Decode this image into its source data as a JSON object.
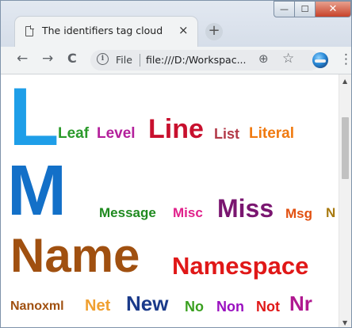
{
  "window": {
    "tab_title": "The identifiers tag cloud",
    "tab_close": "×",
    "new_tab": "+",
    "min_label": "—",
    "max_label": "☐",
    "close_label": "✕"
  },
  "toolbar": {
    "back": "←",
    "forward": "→",
    "reload": "C",
    "scheme": "File",
    "url": "file:///D:/Workspac...",
    "zoom": "⊕",
    "star": "☆",
    "menu": "⋮"
  },
  "tag_cloud": {
    "words": [
      {
        "text": "L",
        "color": "#1e9ee8"
      },
      {
        "text": "Leaf",
        "color": "#2a9a2a"
      },
      {
        "text": "Level",
        "color": "#b4209c"
      },
      {
        "text": "Line",
        "color": "#c8102e"
      },
      {
        "text": "List",
        "color": "#b23a48"
      },
      {
        "text": "Literal",
        "color": "#f07a10"
      },
      {
        "text": "M",
        "color": "#1370c8"
      },
      {
        "text": "Message",
        "color": "#1f8a1f"
      },
      {
        "text": "Misc",
        "color": "#e0208a"
      },
      {
        "text": "Miss",
        "color": "#7a1670"
      },
      {
        "text": "Msg",
        "color": "#e25010"
      },
      {
        "text": "N",
        "color": "#a87a10"
      },
      {
        "text": "Name",
        "color": "#a05010"
      },
      {
        "text": "Namespace",
        "color": "#e01818"
      },
      {
        "text": "Nanoxml",
        "color": "#a05010"
      },
      {
        "text": "Net",
        "color": "#f0a030"
      },
      {
        "text": "New",
        "color": "#1a3a8a"
      },
      {
        "text": "No",
        "color": "#3aa020"
      },
      {
        "text": "Non",
        "color": "#9a10c0"
      },
      {
        "text": "Not",
        "color": "#e01818"
      },
      {
        "text": "Nr",
        "color": "#b01890"
      }
    ]
  },
  "scrollbar": {
    "up": "▲",
    "down": "▼"
  }
}
